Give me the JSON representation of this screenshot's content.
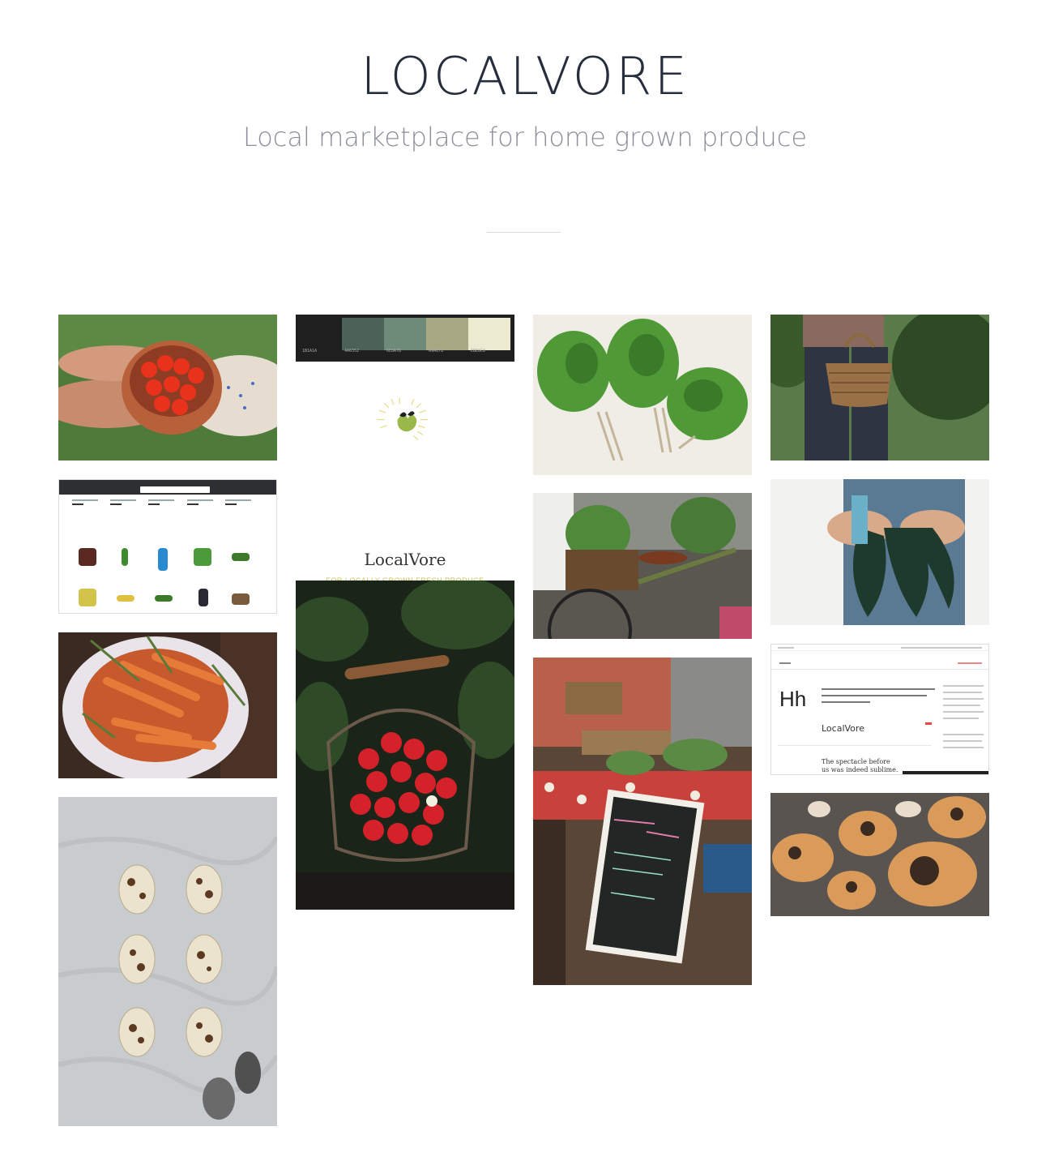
{
  "header": {
    "title": "LOCALVORE",
    "subtitle": "Local marketplace for home grown produce"
  },
  "gallery": {
    "palette": {
      "colors": [
        "#1f1f1f",
        "#4a6356",
        "#6e8a79",
        "#a8a884",
        "#ecead0"
      ],
      "codes": [
        "1B1A1A",
        "4A6352",
        "6E8A7B",
        "A9A878",
        "EBE8C8"
      ]
    },
    "logo": {
      "name": "LocalVore",
      "tagline": "FOR LOCALLY GROWN FRESH PRODUCE"
    },
    "font_spec": {
      "sample_glyph": "Hh",
      "sample_name": "LocalVore",
      "sample_sentence": "The spectacle before us was indeed sublime."
    }
  }
}
